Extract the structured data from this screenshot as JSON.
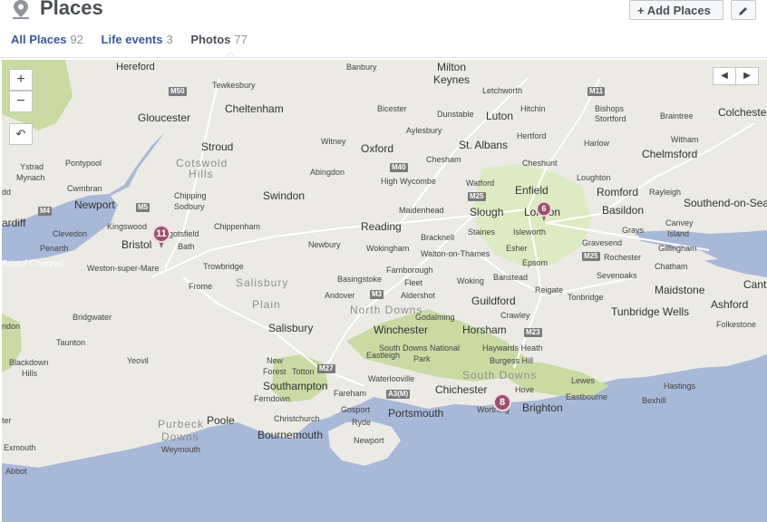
{
  "header": {
    "title": "Places",
    "add_button": "+ Add Places",
    "edit_icon": "pencil-icon"
  },
  "tabs": [
    {
      "label": "All Places",
      "count": "92"
    },
    {
      "label": "Life events",
      "count": "3"
    },
    {
      "label": "Photos",
      "count": "77"
    }
  ],
  "map": {
    "zoom_in": "+",
    "zoom_out": "−",
    "reset": "↶",
    "prev": "◀",
    "next": "▶",
    "pins": [
      "11",
      "6",
      "8"
    ],
    "labels": {
      "hereford": "Hereford",
      "banbury": "Banbury",
      "milton": "Milton",
      "keynes": "Keynes",
      "tewkesbury": "Tewkesbury",
      "letchworth": "Letchworth",
      "gloucester": "Gloucester",
      "cheltenham": "Cheltenham",
      "bicester": "Bicester",
      "dunstable": "Dunstable",
      "luton": "Luton",
      "hitchin": "Hitchin",
      "bishops": "Bishops",
      "stortford": "Stortford",
      "braintree": "Braintree",
      "colchester": "Colchester",
      "stroud": "Stroud",
      "witney": "Witney",
      "oxford": "Oxford",
      "aylesbury": "Aylesbury",
      "st_albans": "St. Albans",
      "hertford": "Hertford",
      "harlow": "Harlow",
      "witham": "Witham",
      "chelmsford": "Chelmsford",
      "pontypool": "Pontypool",
      "ystrad": "Ystrad",
      "mynach": "Mynach",
      "cwmbran": "Cwmbran",
      "cotswold": "Cotswold",
      "hills": "Hills",
      "abingdon": "Abingdon",
      "chesham": "Chesham",
      "cheshunt": "Cheshunt",
      "high_wycombe": "High Wycombe",
      "watford": "Watford",
      "enfield": "Enfield",
      "loughton": "Loughton",
      "romford": "Romford",
      "rayleigh": "Rayleigh",
      "southend": "Southend-on-Sea",
      "newport": "Newport",
      "chipping": "Chipping",
      "sodbury": "Sodbury",
      "swindon": "Swindon",
      "maidenhead": "Maidenhead",
      "slough": "Slough",
      "london": "London",
      "basildon": "Basildon",
      "canvey": "Canvey",
      "island": "Island",
      "cardiff": "ardiff",
      "clevedon": "Clevedon",
      "kingswood": "Kingswood",
      "chippenham": "Chippenham",
      "reading": "Reading",
      "staines": "Staines",
      "isleworth": "Isleworth",
      "grays": "Grays",
      "penarth": "Penarth",
      "bristol": "Bristol",
      "bath": "Bath",
      "cotsfield": "gotsfield",
      "bracknell": "Bracknell",
      "newbury": "Newbury",
      "wokingham": "Wokingham",
      "esher": "Esher",
      "gravesend": "Gravesend",
      "gillingham": "Gillingham",
      "bristol_channel": "Bristol Channel",
      "wsm": "Weston-super-Mare",
      "trowbridge": "Trowbridge",
      "walton": "Walton-on-Thames",
      "epsom": "Epsom",
      "rochester": "Rochester",
      "chatham": "Chatham",
      "farnborough": "Farnborough",
      "banstead": "Banstead",
      "sevenoaks": "Sevenoaks",
      "basingstoke": "Basingstoke",
      "fleet": "Fleet",
      "woking": "Woking",
      "salisbury_plain_a": "Salisbury",
      "salisbury_plain_b": "Plain",
      "frome": "Frome",
      "andover": "Andover",
      "aldershot": "Aldershot",
      "reigate": "Reigate",
      "tonbridge": "Tonbridge",
      "maidstone": "Maidstone",
      "cant": "Cant",
      "guildford": "Guildford",
      "north_downs": "North Downs",
      "ashford": "Ashford",
      "bridgwater": "Bridgwater",
      "crawley": "Crawley",
      "tunbridge": "Tunbridge Wells",
      "godalming": "Godalming",
      "folkestone": "Folkestone",
      "salisbury": "Salisbury",
      "winchester": "Winchester",
      "horsham": "Horsham",
      "taunton": "Taunton",
      "haywards": "Haywards Heath",
      "eastleigh": "Eastleigh",
      "sdn_a": "South Downs National",
      "sdn_b": "Park",
      "burgess": "Burgess Hill",
      "yeovil": "Yeovil",
      "blackdown": "Blackdown",
      "bd_hills": "Hills",
      "new_forest_a": "New",
      "new_forest_b": "Forest",
      "totton": "Totton",
      "waterlooville": "Waterlooville",
      "south_downs": "South Downs",
      "lewes": "Lewes",
      "southampton": "Southampton",
      "chichester": "Chichester",
      "hove": "Hove",
      "eastbourne": "Eastbourne",
      "hastings": "Hastings",
      "bexhill": "Bexhill",
      "ferndown": "Ferndown",
      "fareham": "Fareham",
      "gosport": "Gosport",
      "worthing": "Worthing",
      "brighton": "Brighton",
      "christchurch": "Christchurch",
      "purbeck": "Purbeck",
      "p_downs": "Downs",
      "poole": "Poole",
      "ryde": "Ryde",
      "portsmouth": "Portsmouth",
      "weymouth": "Weymouth",
      "bournemouth": "Bournemouth",
      "newport_iow": "Newport",
      "exmouth": "Exmouth",
      "abbot": "Abbot",
      "ter": "ter",
      "ndon": "ndon",
      "dd": "dd"
    },
    "shields": [
      "M50",
      "M11",
      "M4",
      "M40",
      "M25",
      "M5",
      "M3",
      "M27",
      "M23",
      "A3(M)",
      "M25"
    ]
  }
}
